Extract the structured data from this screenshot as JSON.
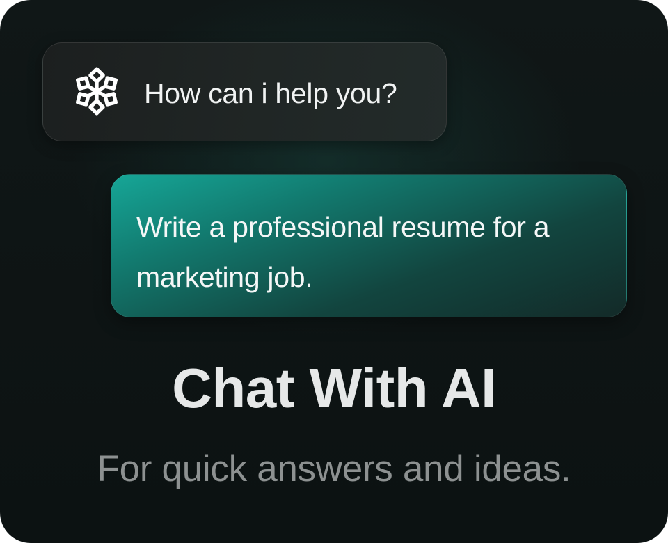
{
  "assistant_message": {
    "icon": "ai-logo-icon",
    "text": "How can i help you?"
  },
  "user_message": {
    "text": "Write a professional resume for a marketing job."
  },
  "heading": {
    "title": "Chat With AI",
    "subtitle": "For quick answers and ideas."
  },
  "colors": {
    "background": "#0d1414",
    "assistant_bubble": "#1f2424",
    "user_bubble_accent": "#16a697",
    "title_text": "#e6e8e8",
    "subtitle_text": "#8d9191"
  }
}
